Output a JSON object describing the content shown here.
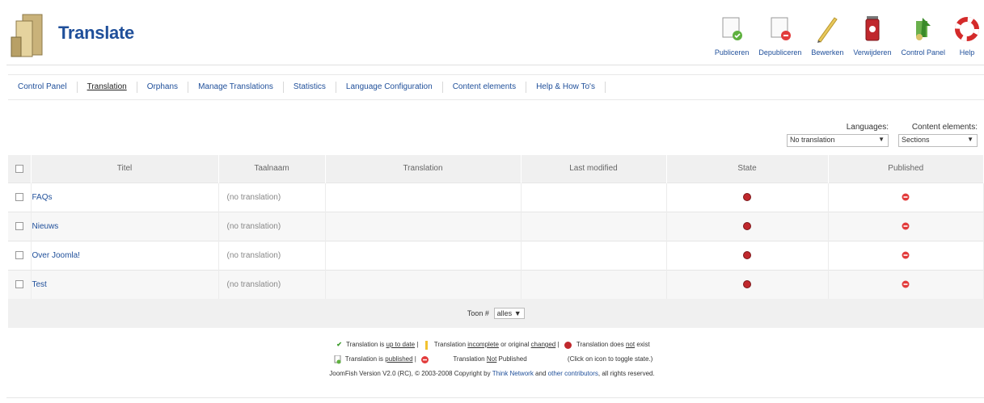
{
  "header": {
    "title": "Translate",
    "toolbar": [
      {
        "label": "Publiceren",
        "icon": "publish-icon"
      },
      {
        "label": "Depubliceren",
        "icon": "unpublish-icon"
      },
      {
        "label": "Bewerken",
        "icon": "edit-icon"
      },
      {
        "label": "Verwijderen",
        "icon": "delete-icon"
      },
      {
        "label": "Control Panel",
        "icon": "control-panel-icon"
      },
      {
        "label": "Help",
        "icon": "help-icon"
      }
    ]
  },
  "submenu": [
    {
      "label": "Control Panel",
      "active": false
    },
    {
      "label": "Translation",
      "active": true
    },
    {
      "label": "Orphans",
      "active": false
    },
    {
      "label": "Manage Translations",
      "active": false
    },
    {
      "label": "Statistics",
      "active": false
    },
    {
      "label": "Language Configuration",
      "active": false
    },
    {
      "label": "Content elements",
      "active": false
    },
    {
      "label": "Help & How To's",
      "active": false
    }
  ],
  "filters": {
    "languages_label": "Languages:",
    "languages_value": "No translation",
    "elements_label": "Content elements:",
    "elements_value": "Sections"
  },
  "table": {
    "columns": [
      "Titel",
      "Taalnaam",
      "Translation",
      "Last modified",
      "State",
      "Published"
    ],
    "rows": [
      {
        "title": "FAQs",
        "taalnaam": "(no translation)",
        "translation": "",
        "last_modified": ""
      },
      {
        "title": "Nieuws",
        "taalnaam": "(no translation)",
        "translation": "",
        "last_modified": ""
      },
      {
        "title": "Over Joomla!",
        "taalnaam": "(no translation)",
        "translation": "",
        "last_modified": ""
      },
      {
        "title": "Test",
        "taalnaam": "(no translation)",
        "translation": "",
        "last_modified": ""
      }
    ],
    "pager_label": "Toon #",
    "pager_value": "alles"
  },
  "legend": {
    "l1_a": "Translation is",
    "l1_b": "up to date",
    "l1_c": "| ",
    "l1_d": "Translation",
    "l1_e": "incomplete",
    "l1_f": "or original",
    "l1_g": "changed",
    "l1_h": "|",
    "l1_i": "Translation does",
    "l1_j": "not",
    "l1_k": "exist",
    "l2_a": "Translation is",
    "l2_b": "published",
    "l2_c": "|",
    "l2_d": "Translation",
    "l2_e": "Not",
    "l2_f": "Published",
    "l2_g": "(Click on icon to toggle state.)",
    "l3_a": "JoomFish Version V2.0 (RC), © 2003-2008 Copyright by",
    "l3_b": "Think Network",
    "l3_c": "and",
    "l3_d": "other contributors",
    "l3_e": ", all rights reserved."
  },
  "colors": {
    "link": "#1f4f9a",
    "state_red": "#c0282d",
    "published_red": "#e23b3b",
    "check_green": "#3a9a2a"
  }
}
